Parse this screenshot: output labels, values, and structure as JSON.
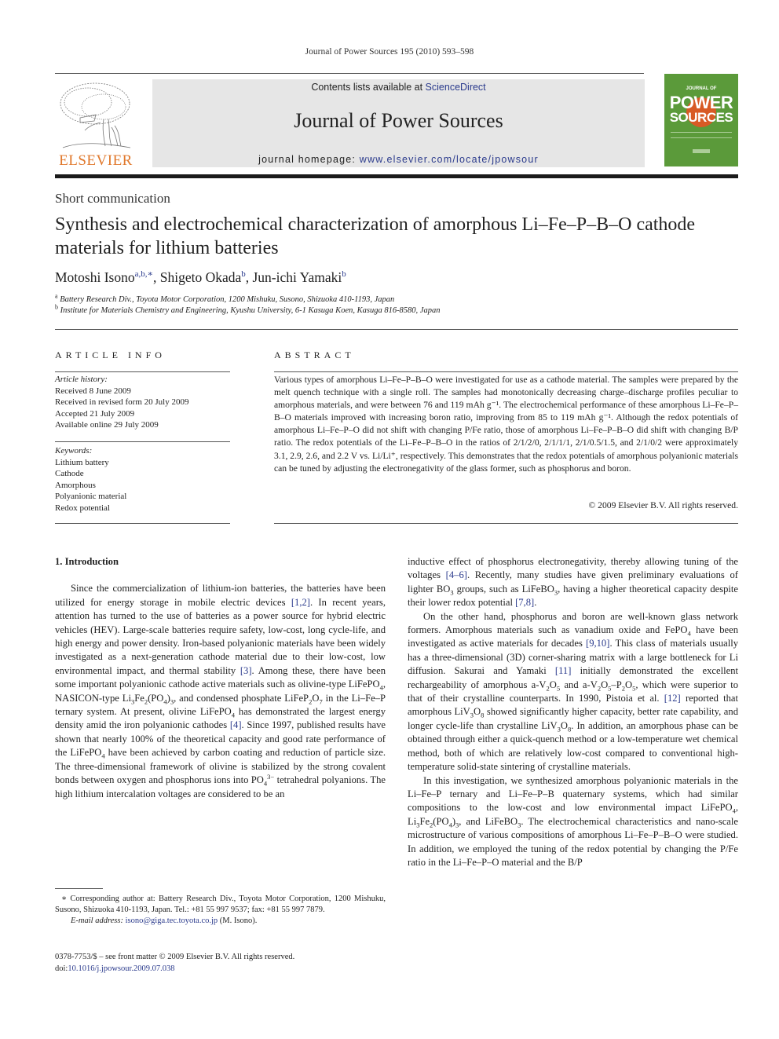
{
  "header": {
    "running_head": "Journal of Power Sources 195 (2010) 593–598",
    "publisher_logo_text": "ELSEVIER",
    "contents_prefix": "Contents lists available at ",
    "contents_link": "ScienceDirect",
    "journal_title": "Journal of Power Sources",
    "homepage_prefix": "journal homepage: ",
    "homepage_link": "www.elsevier.com/locate/jpowsour",
    "cover": {
      "top_text": "JOURNAL OF",
      "word1": "POWER",
      "word2": "SOURCES",
      "bg_color": "#5b9a3a",
      "accent_color": "#d85a25"
    },
    "logo_color": "#e0782c",
    "link_color": "#2a3a8c"
  },
  "article": {
    "type": "Short communication",
    "title": "Synthesis and electrochemical characterization of amorphous Li–Fe–P–B–O cathode materials for lithium batteries",
    "authors": [
      {
        "name": "Motoshi Isono",
        "marks": "a,b,∗",
        "sep": ", "
      },
      {
        "name": "Shigeto Okada",
        "marks": "b",
        "sep": ", "
      },
      {
        "name": "Jun-ichi Yamaki",
        "marks": "b",
        "sep": ""
      }
    ],
    "affiliations": [
      {
        "mark": "a",
        "text": "Battery Research Div., Toyota Motor Corporation, 1200 Mishuku, Susono, Shizuoka 410-1193, Japan"
      },
      {
        "mark": "b",
        "text": "Institute for Materials Chemistry and Engineering, Kyushu University, 6-1 Kasuga Koen, Kasuga 816-8580, Japan"
      }
    ]
  },
  "article_info": {
    "heading": "ARTICLE INFO",
    "history_label": "Article history:",
    "history": [
      "Received 8 June 2009",
      "Received in revised form 20 July 2009",
      "Accepted 21 July 2009",
      "Available online 29 July 2009"
    ],
    "keywords_label": "Keywords:",
    "keywords": [
      "Lithium battery",
      "Cathode",
      "Amorphous",
      "Polyanionic material",
      "Redox potential"
    ]
  },
  "abstract": {
    "heading": "ABSTRACT",
    "text": "Various types of amorphous Li–Fe–P–B–O were investigated for use as a cathode material. The samples were prepared by the melt quench technique with a single roll. The samples had monotonically decreasing charge–discharge profiles peculiar to amorphous materials, and were between 76 and 119 mAh g⁻¹. The electrochemical performance of these amorphous Li–Fe–P–B–O materials improved with increasing boron ratio, improving from 85 to 119 mAh g⁻¹. Although the redox potentials of amorphous Li–Fe–P–O did not shift with changing P/Fe ratio, those of amorphous Li–Fe–P–B–O did shift with changing B/P ratio. The redox potentials of the Li–Fe–P–B–O in the ratios of 2/1/2/0, 2/1/1/1, 2/1/0.5/1.5, and 2/1/0/2 were approximately 3.1, 2.9, 2.6, and 2.2 V vs. Li/Li⁺, respectively. This demonstrates that the redox potentials of amorphous polyanionic materials can be tuned by adjusting the electronegativity of the glass former, such as phosphorus and boron.",
    "copyright": "© 2009 Elsevier B.V. All rights reserved."
  },
  "body": {
    "section_heading": "1.  Introduction",
    "left_paragraphs": [
      [
        {
          "t": "Since the commercialization of lithium-ion batteries, the batteries have been utilized for energy storage in mobile electric devices "
        },
        {
          "ref": "[1,2]"
        },
        {
          "t": ". In recent years, attention has turned to the use of batteries as a power source for hybrid electric vehicles (HEV). Large-scale batteries require safety, low-cost, long cycle-life, and high energy and power density. Iron-based polyanionic materials have been widely investigated as a next-generation cathode material due to their low-cost, low environmental impact, and thermal stability "
        },
        {
          "ref": "[3]"
        },
        {
          "t": ". Among these, there have been some important polyanionic cathode active materials such as olivine-type LiFePO"
        },
        {
          "sub": "4"
        },
        {
          "t": ", NASICON-type Li"
        },
        {
          "sub": "3"
        },
        {
          "t": "Fe"
        },
        {
          "sub": "2"
        },
        {
          "t": "(PO"
        },
        {
          "sub": "4"
        },
        {
          "t": ")"
        },
        {
          "sub": "3"
        },
        {
          "t": ", and condensed phosphate LiFeP"
        },
        {
          "sub": "2"
        },
        {
          "t": "O"
        },
        {
          "sub": "7"
        },
        {
          "t": " in the Li–Fe–P ternary system. At present, olivine LiFePO"
        },
        {
          "sub": "4"
        },
        {
          "t": " has demonstrated the largest energy density amid the iron polyanionic cathodes "
        },
        {
          "ref": "[4]"
        },
        {
          "t": ". Since 1997, published results have shown that nearly 100% of the theoretical capacity and good rate performance of the LiFePO"
        },
        {
          "sub": "4"
        },
        {
          "t": " have been achieved by carbon coating and reduction of particle size. The three-dimensional framework of olivine is stabilized by the strong covalent bonds between oxygen and phosphorus ions into PO"
        },
        {
          "sub": "4"
        },
        {
          "sup": "3−"
        },
        {
          "t": " tetrahedral polyanions. The high lithium intercalation voltages are considered to be an"
        }
      ]
    ],
    "right_paragraphs": [
      {
        "indent": false,
        "runs": [
          {
            "t": "inductive effect of phosphorus electronegativity, thereby allowing tuning of the voltages "
          },
          {
            "ref": "[4–6]"
          },
          {
            "t": ". Recently, many studies have given preliminary evaluations of lighter BO"
          },
          {
            "sub": "3"
          },
          {
            "t": " groups, such as LiFeBO"
          },
          {
            "sub": "3"
          },
          {
            "t": ", having a higher theoretical capacity despite their lower redox potential "
          },
          {
            "ref": "[7,8]"
          },
          {
            "t": "."
          }
        ]
      },
      {
        "indent": true,
        "runs": [
          {
            "t": "On the other hand, phosphorus and boron are well-known glass network formers. Amorphous materials such as vanadium oxide and FePO"
          },
          {
            "sub": "4"
          },
          {
            "t": " have been investigated as active materials for decades "
          },
          {
            "ref": "[9,10]"
          },
          {
            "t": ". This class of materials usually has a three-dimensional (3D) corner-sharing matrix with a large bottleneck for Li diffusion. Sakurai and Yamaki "
          },
          {
            "ref": "[11]"
          },
          {
            "t": " initially demonstrated the excellent rechargeability of amorphous a-V"
          },
          {
            "sub": "2"
          },
          {
            "t": "O"
          },
          {
            "sub": "5"
          },
          {
            "t": " and a-V"
          },
          {
            "sub": "2"
          },
          {
            "t": "O"
          },
          {
            "sub": "5"
          },
          {
            "t": "–P"
          },
          {
            "sub": "2"
          },
          {
            "t": "O"
          },
          {
            "sub": "5"
          },
          {
            "t": ", which were superior to that of their crystalline counterparts. In 1990, Pistoia et al. "
          },
          {
            "ref": "[12]"
          },
          {
            "t": " reported that amorphous LiV"
          },
          {
            "sub": "3"
          },
          {
            "t": "O"
          },
          {
            "sub": "8"
          },
          {
            "t": " showed significantly higher capacity, better rate capability, and longer cycle-life than crystalline LiV"
          },
          {
            "sub": "3"
          },
          {
            "t": "O"
          },
          {
            "sub": "8"
          },
          {
            "t": ". In addition, an amorphous phase can be obtained through either a quick-quench method or a low-temperature wet chemical method, both of which are relatively low-cost compared to conventional high-temperature solid-state sintering of crystalline materials."
          }
        ]
      },
      {
        "indent": true,
        "runs": [
          {
            "t": "In this investigation, we synthesized amorphous polyanionic materials in the Li–Fe–P ternary and Li–Fe–P–B quaternary systems, which had similar compositions to the low-cost and low environmental impact LiFePO"
          },
          {
            "sub": "4"
          },
          {
            "t": ", Li"
          },
          {
            "sub": "3"
          },
          {
            "t": "Fe"
          },
          {
            "sub": "2"
          },
          {
            "t": "(PO"
          },
          {
            "sub": "4"
          },
          {
            "t": ")"
          },
          {
            "sub": "3"
          },
          {
            "t": ", and LiFeBO"
          },
          {
            "sub": "3"
          },
          {
            "t": ". The electrochemical characteristics and nano-scale microstructure of various compositions of amorphous Li–Fe–P–B–O were studied. In addition, we employed the tuning of the redox potential by changing the P/Fe ratio in the Li–Fe–P–O material and the B/P"
          }
        ]
      }
    ]
  },
  "footnote": {
    "mark": "∗",
    "text": "Corresponding author at: Battery Research Div., Toyota Motor Corporation, 1200 Mishuku, Susono, Shizuoka 410-1193, Japan. Tel.: +81 55 997 9537; fax: +81 55 997 7879.",
    "email_label": "E-mail address:",
    "email": "isono@giga.tec.toyota.co.jp",
    "email_suffix": " (M. Isono)."
  },
  "frontmatter": {
    "issn_line": "0378-7753/$ – see front matter © 2009 Elsevier B.V. All rights reserved.",
    "doi_prefix": "doi:",
    "doi": "10.1016/j.jpowsour.2009.07.038"
  }
}
